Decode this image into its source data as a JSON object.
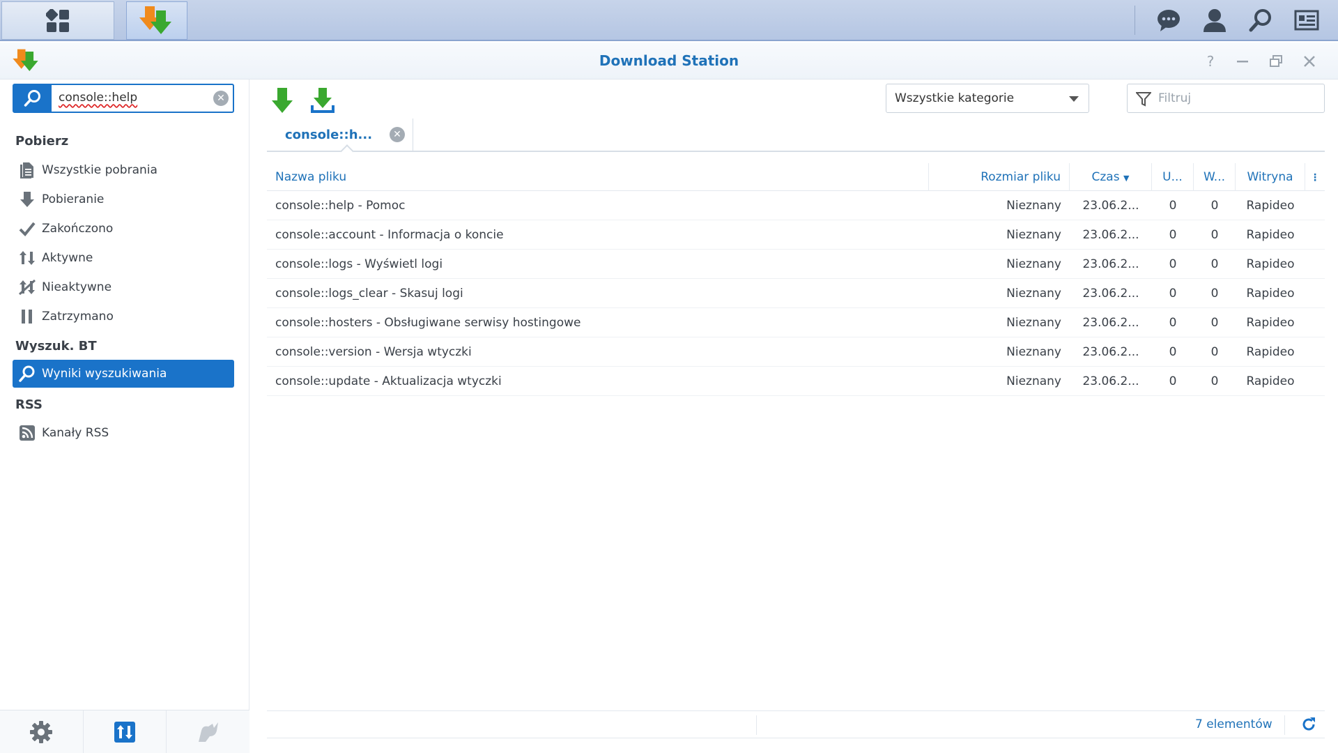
{
  "window": {
    "title": "Download Station"
  },
  "sidebar": {
    "search_value": "console::help",
    "sections": {
      "download": "Pobierz",
      "bt_search": "Wyszuk. BT",
      "rss": "RSS"
    },
    "items": [
      {
        "label": "Wszystkie pobrania",
        "icon": "document-icon"
      },
      {
        "label": "Pobieranie",
        "icon": "arrow-down-icon"
      },
      {
        "label": "Zakończono",
        "icon": "checkmark-icon"
      },
      {
        "label": "Aktywne",
        "icon": "up-down-arrows-icon"
      },
      {
        "label": "Nieaktywne",
        "icon": "inactive-icon"
      },
      {
        "label": "Zatrzymano",
        "icon": "pause-icon"
      },
      {
        "label": "Wyniki wyszukiwania",
        "icon": "search-icon",
        "active": true
      },
      {
        "label": "Kanały RSS",
        "icon": "rss-icon"
      }
    ]
  },
  "toolbar": {
    "category": "Wszystkie kategorie",
    "filter_placeholder": "Filtruj"
  },
  "tab": {
    "label": "console::h..."
  },
  "table": {
    "columns": {
      "name": "Nazwa pliku",
      "size": "Rozmiar pliku",
      "time": "Czas",
      "u": "U...",
      "w": "W...",
      "site": "Witryna"
    },
    "rows": [
      {
        "name": "console::help - Pomoc",
        "size": "Nieznany",
        "time": "23.06.2...",
        "u": "0",
        "w": "0",
        "site": "Rapideo"
      },
      {
        "name": "console::account - Informacja o koncie",
        "size": "Nieznany",
        "time": "23.06.2...",
        "u": "0",
        "w": "0",
        "site": "Rapideo"
      },
      {
        "name": "console::logs - Wyświetl logi",
        "size": "Nieznany",
        "time": "23.06.2...",
        "u": "0",
        "w": "0",
        "site": "Rapideo"
      },
      {
        "name": "console::logs_clear - Skasuj logi",
        "size": "Nieznany",
        "time": "23.06.2...",
        "u": "0",
        "w": "0",
        "site": "Rapideo"
      },
      {
        "name": "console::hosters - Obsługiwane serwisy hostingowe",
        "size": "Nieznany",
        "time": "23.06.2...",
        "u": "0",
        "w": "0",
        "site": "Rapideo"
      },
      {
        "name": "console::version - Wersja wtyczki",
        "size": "Nieznany",
        "time": "23.06.2...",
        "u": "0",
        "w": "0",
        "site": "Rapideo"
      },
      {
        "name": "console::update - Aktualizacja wtyczki",
        "size": "Nieznany",
        "time": "23.06.2...",
        "u": "0",
        "w": "0",
        "site": "Rapideo"
      }
    ]
  },
  "status": {
    "count": "7 elementów"
  },
  "colors": {
    "accent": "#1a73c9",
    "title": "#1f72b8",
    "green": "#3aa82f",
    "orange": "#f08a1c"
  }
}
